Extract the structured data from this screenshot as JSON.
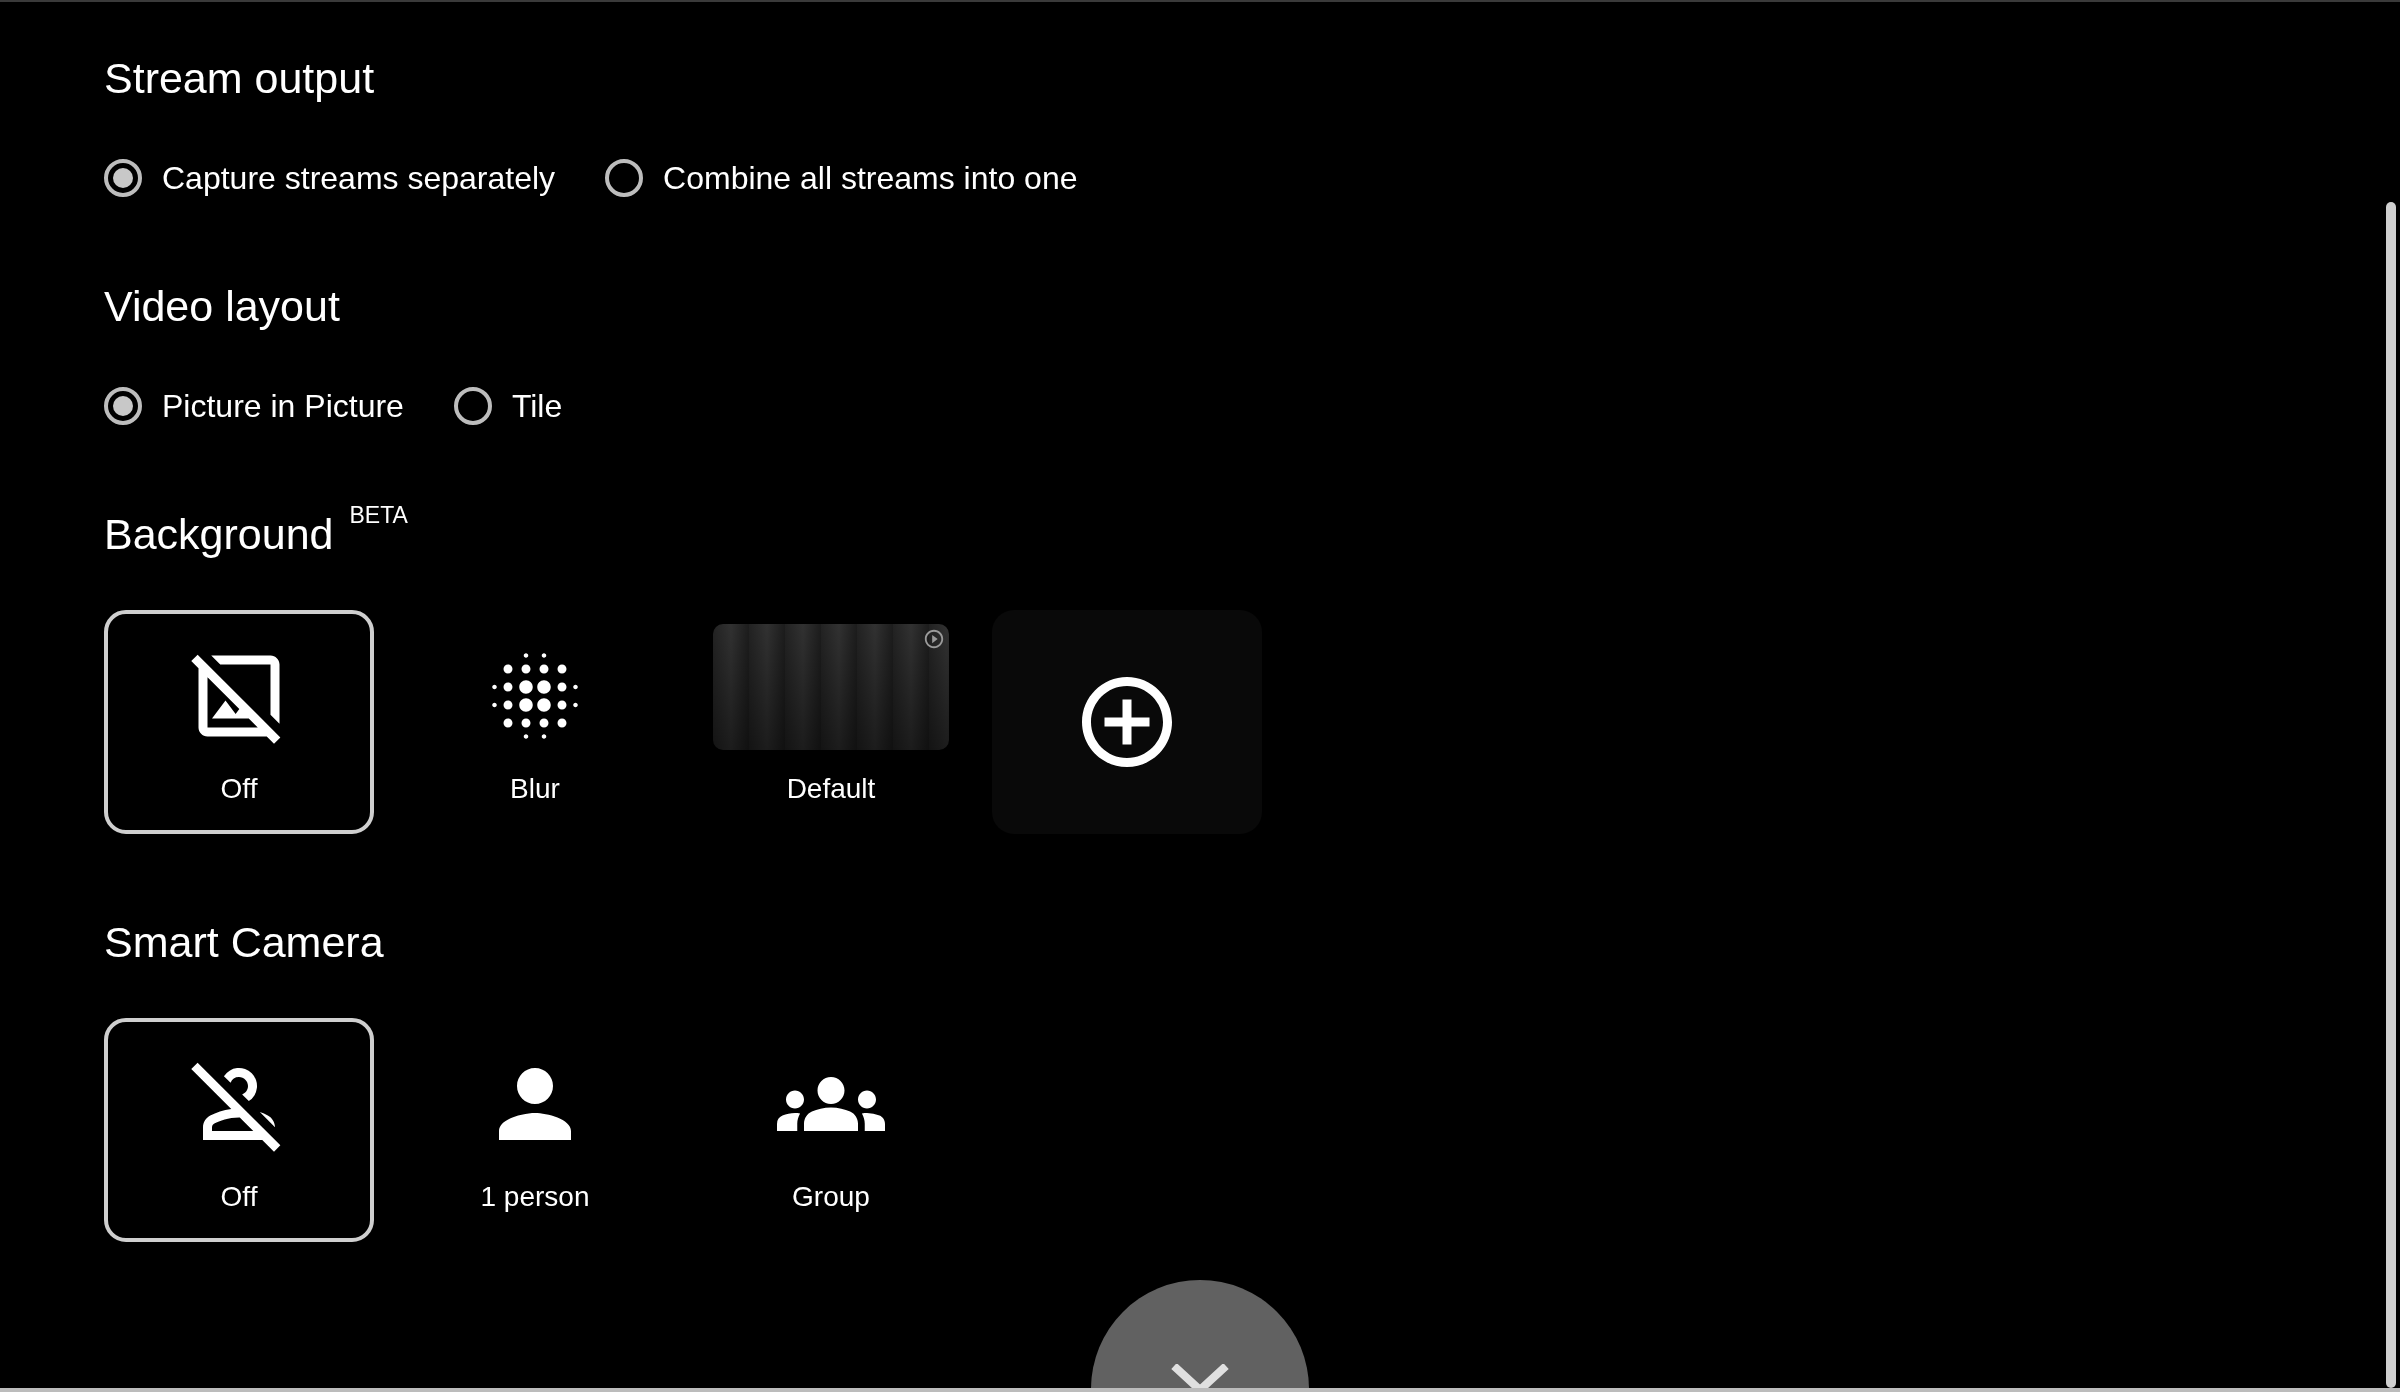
{
  "sections": [
    {
      "title": "Stream output",
      "kind": "radio",
      "options": [
        {
          "label": "Capture streams separately",
          "selected": true
        },
        {
          "label": "Combine all streams into one",
          "selected": false
        }
      ]
    },
    {
      "title": "Video layout",
      "kind": "radio",
      "options": [
        {
          "label": "Picture in Picture",
          "selected": true
        },
        {
          "label": "Tile",
          "selected": false
        }
      ]
    },
    {
      "title": "Background",
      "badge": "BETA",
      "kind": "tiles",
      "options": [
        {
          "kind": "image-off",
          "label": "Off",
          "selected": true
        },
        {
          "kind": "blur",
          "label": "Blur",
          "selected": false
        },
        {
          "kind": "image",
          "label": "Default",
          "selected": false
        },
        {
          "kind": "add",
          "selected": false
        }
      ]
    },
    {
      "title": "Smart Camera",
      "kind": "tiles",
      "options": [
        {
          "kind": "person-off",
          "label": "Off",
          "selected": true
        },
        {
          "kind": "person",
          "label": "1 person",
          "selected": false
        },
        {
          "kind": "group",
          "label": "Group",
          "selected": false
        }
      ]
    }
  ]
}
